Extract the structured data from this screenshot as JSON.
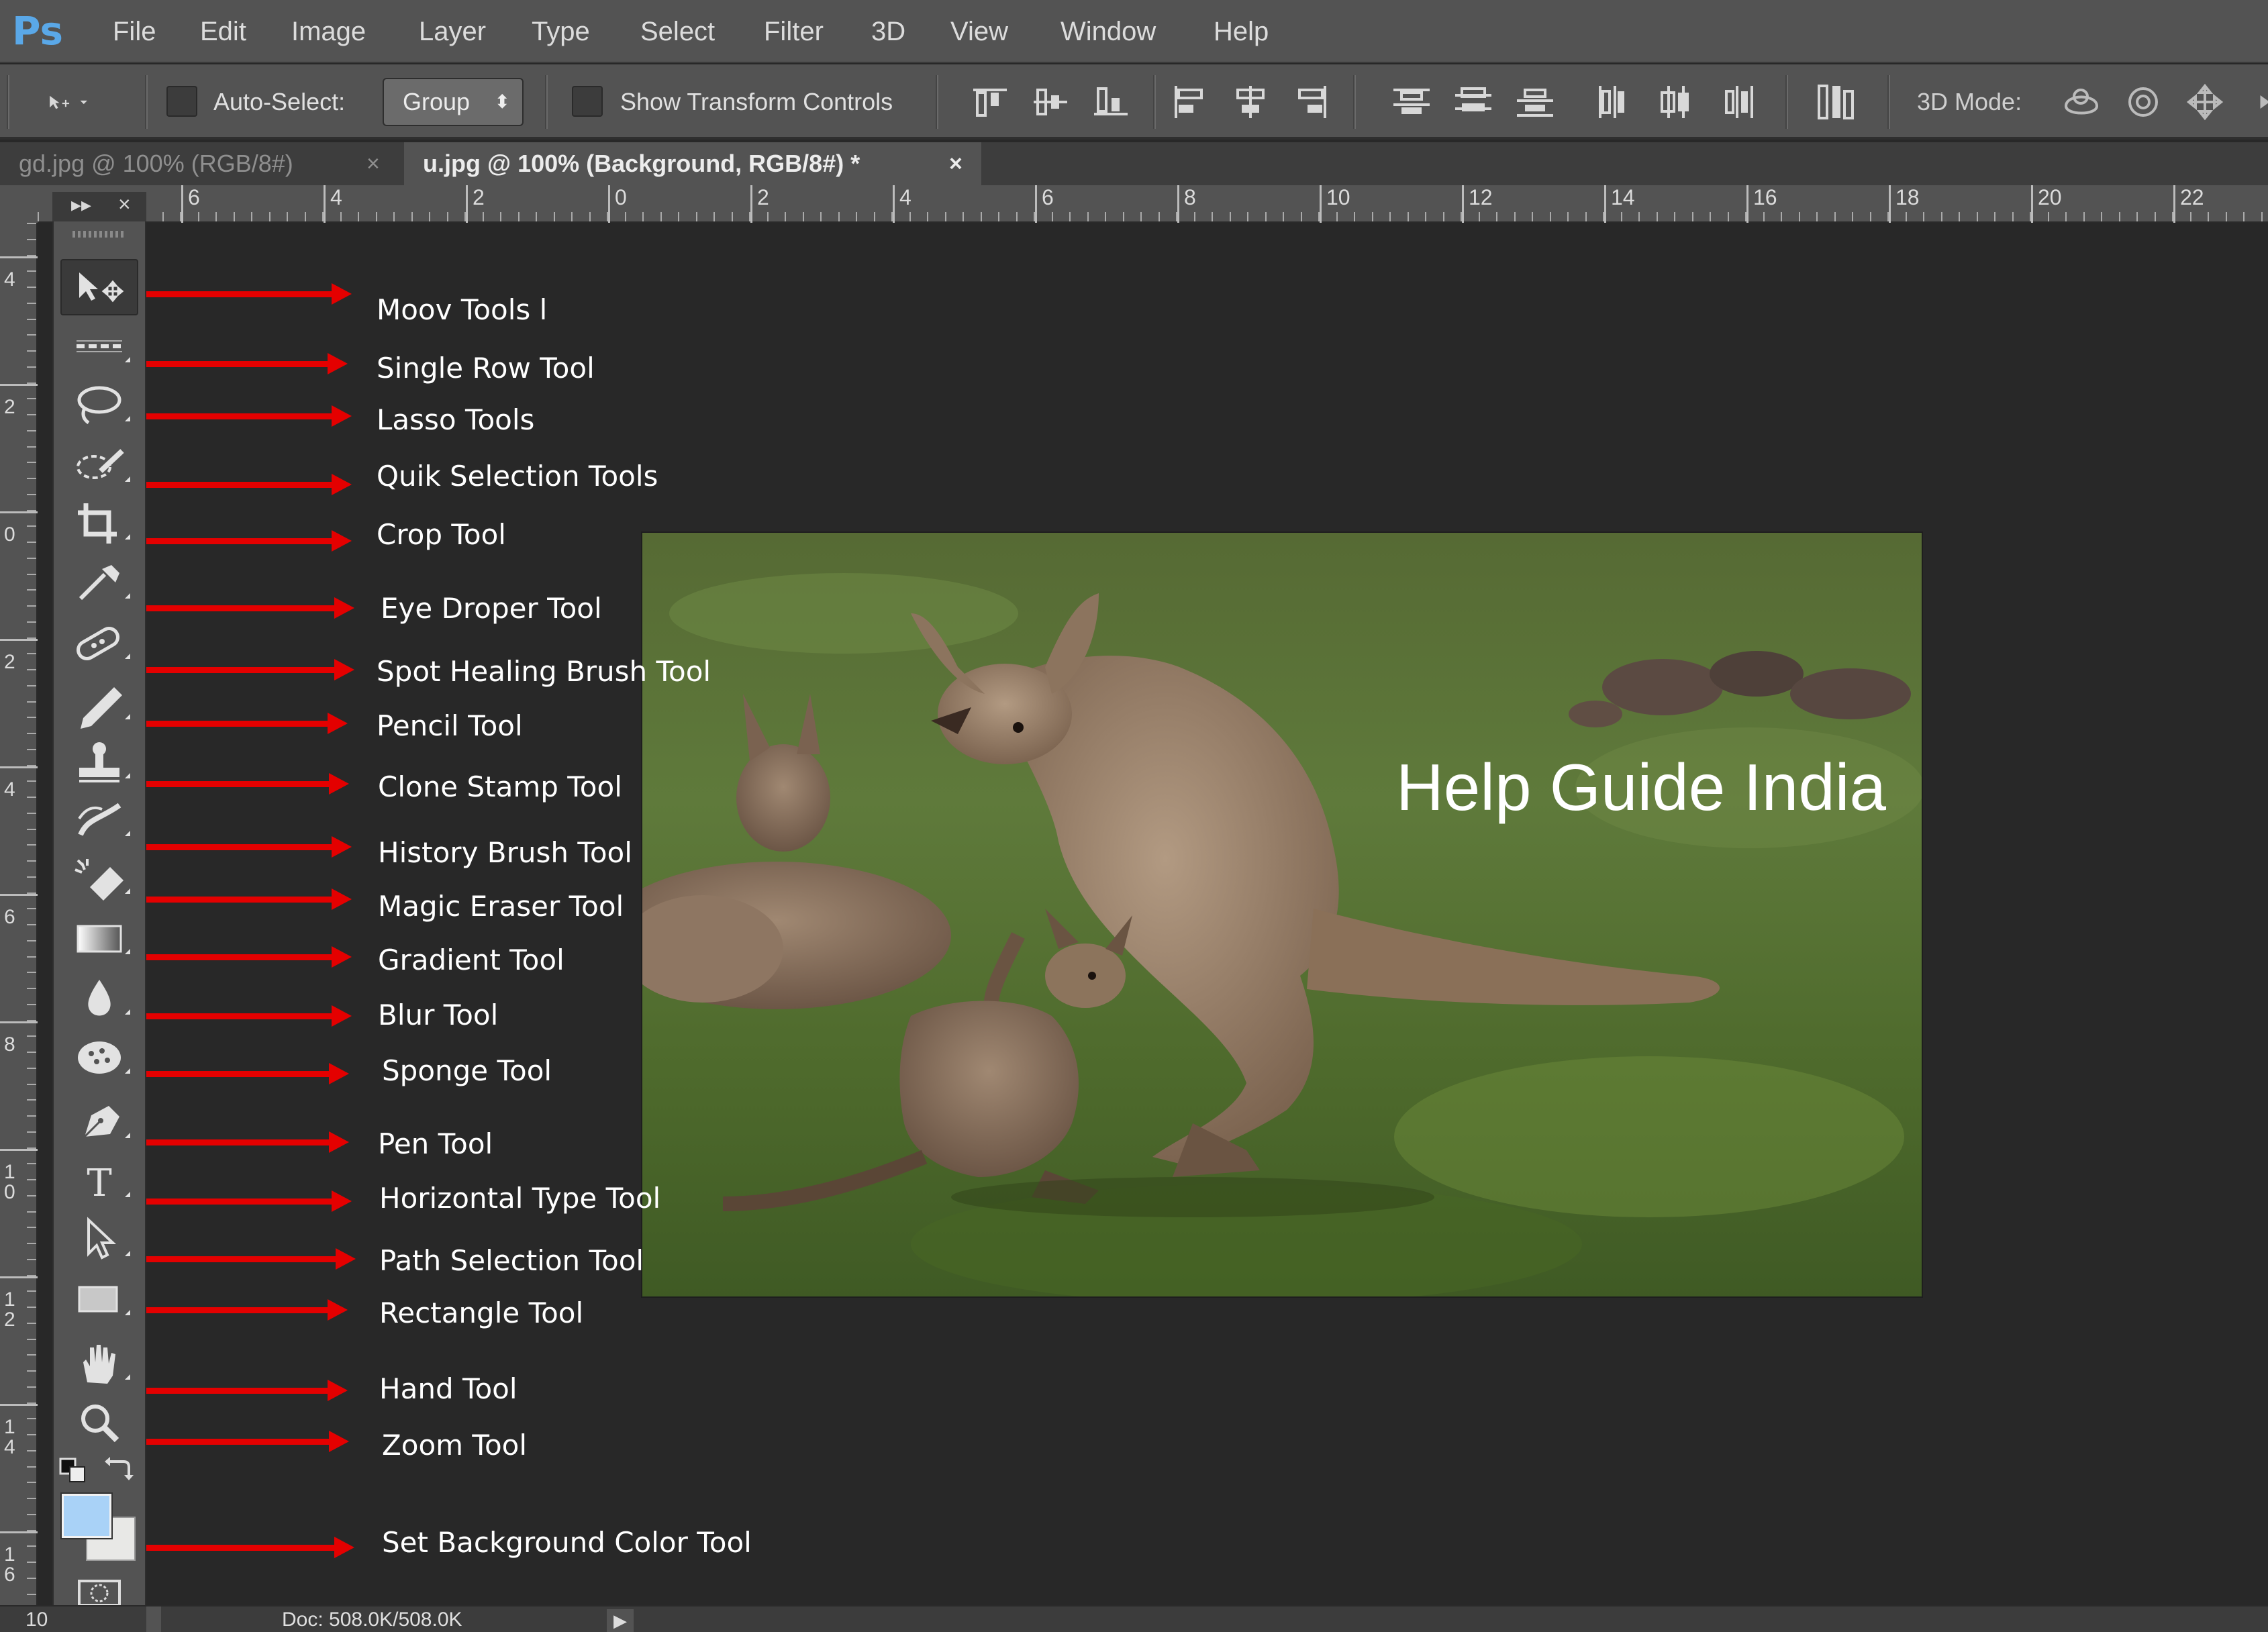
{
  "app": {
    "logo": "Ps",
    "menu": [
      "File",
      "Edit",
      "Image",
      "Layer",
      "Type",
      "Select",
      "Filter",
      "3D",
      "View",
      "Window",
      "Help"
    ]
  },
  "options": {
    "auto_select_label": "Auto-Select:",
    "group_value": "Group",
    "show_transform_label": "Show Transform Controls",
    "mode_3d_label": "3D Mode:"
  },
  "tabs": [
    {
      "label": "gd.jpg @ 100% (RGB/8#)",
      "close": "×"
    },
    {
      "label": "u.jpg @ 100% (Background, RGB/8#) *",
      "close": "×"
    }
  ],
  "ruler_top": [
    "6",
    "4",
    "2",
    "0",
    "2",
    "4",
    "6",
    "8",
    "10",
    "12",
    "14",
    "16",
    "18",
    "20",
    "22"
  ],
  "ruler_left": [
    "4",
    "2",
    "0",
    "2",
    "4",
    "6",
    "8",
    "1\n0",
    "1\n2",
    "1\n4",
    "1\n6"
  ],
  "tools_header": {
    "expand": "▸▸",
    "close": "×"
  },
  "tools": [
    "move-tool-icon",
    "single-row-marquee-icon",
    "lasso-icon",
    "quick-selection-icon",
    "crop-icon",
    "eyedropper-icon",
    "spot-healing-brush-icon",
    "pencil-icon",
    "clone-stamp-icon",
    "history-brush-icon",
    "magic-eraser-icon",
    "gradient-icon",
    "blur-icon",
    "sponge-icon",
    "pen-icon",
    "horizontal-type-icon",
    "path-selection-icon",
    "rectangle-icon",
    "hand-icon",
    "zoom-icon"
  ],
  "annotations": [
    "Moov Tools l",
    "Single Row Tool",
    "Lasso Tools",
    "Quik Selection Tools",
    "Crop Tool",
    "Eye Droper Tool",
    "Spot Healing Brush Tool",
    "Pencil Tool",
    "Clone Stamp Tool",
    "History Brush Tool",
    "Magic Eraser Tool",
    "Gradient Tool",
    "Blur Tool",
    "Sponge Tool",
    "Pen Tool",
    "Horizontal Type Tool",
    "Path Selection Tool",
    "Rectangle Tool",
    "Hand Tool",
    "Zoom Tool",
    "Set Background Color Tool"
  ],
  "image": {
    "watermark": "Help Guide India"
  },
  "colors": {
    "foreground_swatch": "#a9d2f7",
    "background_swatch": "#e8e8e6",
    "arrow": "#e40000",
    "panel": "#535353",
    "workspace": "#282828"
  },
  "status": {
    "zoom": "10",
    "doc": "Doc: 508.0K/508.0K",
    "play": "▶"
  }
}
